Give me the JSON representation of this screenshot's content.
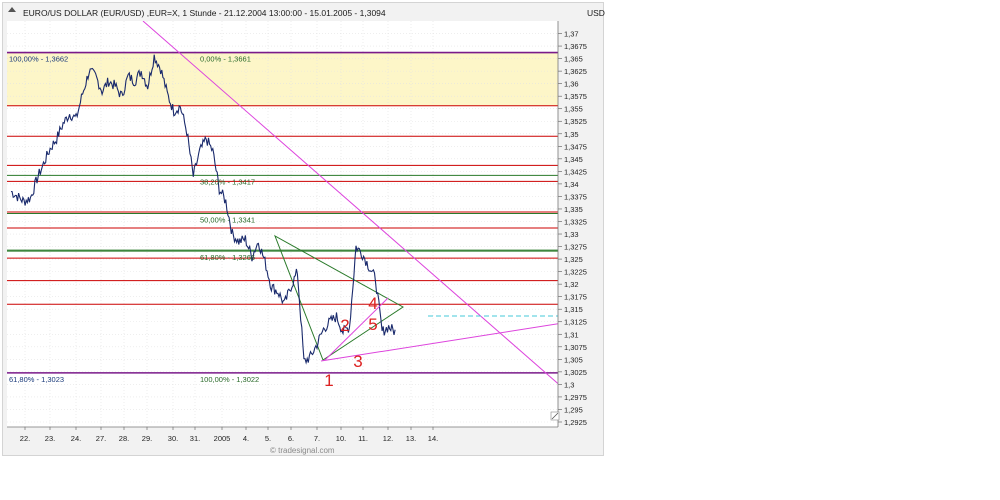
{
  "header": {
    "title": "EURO/US DOLLAR (EUR/USD) ,EUR=X, 1 Stunde - 21.12.2004 13:00:00 - 15.01.2005 - 1,3094",
    "currency": "USD",
    "watermark": "© tradesignal.com"
  },
  "colors": {
    "price": "#1a2a6c",
    "fib_red": "#cc0000",
    "fib_green": "#2a7a2a",
    "fib_purple": "#7a1a8a",
    "trend_magenta": "#dd44dd",
    "zone_yellow": "#fdf6c8",
    "wave_red": "#dd2222",
    "wave_green": "#22aa22",
    "projection_cyan": "#44c8d8"
  },
  "chart_data": {
    "type": "line",
    "title": "EURO/US DOLLAR (EUR/USD) ,EUR=X, 1 Stunde - 21.12.2004 13:00:00 - 15.01.2005 - 1,3094",
    "ylabel": "USD",
    "ylim": [
      1.2915,
      1.3725
    ],
    "y_ticks": [
      1.37,
      1.3675,
      1.365,
      1.3625,
      1.36,
      1.3575,
      1.355,
      1.3525,
      1.35,
      1.3475,
      1.345,
      1.3425,
      1.34,
      1.3375,
      1.335,
      1.3325,
      1.33,
      1.3275,
      1.325,
      1.3225,
      1.32,
      1.3175,
      1.315,
      1.3125,
      1.31,
      1.3075,
      1.305,
      1.3025,
      1.3,
      1.2975,
      1.295,
      1.2925
    ],
    "y_tick_labels": [
      "1,37",
      "1,3675",
      "1,365",
      "1,3625",
      "1,36",
      "1,3575",
      "1,355",
      "1,3525",
      "1,35",
      "1,3475",
      "1,345",
      "1,3425",
      "1,34",
      "1,3375",
      "1,335",
      "1,3325",
      "1,33",
      "1,3275",
      "1,325",
      "1,3225",
      "1,32",
      "1,3175",
      "1,315",
      "1,3125",
      "1,31",
      "1,3075",
      "1,305",
      "1,3025",
      "1,3",
      "1,2975",
      "1,295",
      "1,2925"
    ],
    "x_labels": [
      "22.",
      "23.",
      "24.",
      "27.",
      "28.",
      "29.",
      "30.",
      "31.",
      "2005",
      "4.",
      "5.",
      "6.",
      "7.",
      "10.",
      "11.",
      "12.",
      "13.",
      "14."
    ],
    "series": [
      {
        "x": [
          0,
          0.3,
          0.6,
          0.9,
          1.2,
          1.5,
          1.8,
          2.1,
          2.4,
          2.7,
          3.0,
          3.3,
          3.6,
          3.9,
          4.2,
          4.5,
          4.8,
          5.1,
          5.4,
          5.7,
          6.0,
          6.3,
          6.6,
          6.9,
          7.2,
          7.5,
          7.8,
          8.1,
          8.4,
          8.7,
          9.0,
          9.3,
          9.6,
          9.9,
          10.2,
          10.5,
          10.8,
          11.1,
          11.4,
          11.7,
          12.0,
          12.3,
          12.6,
          12.9,
          13.2,
          13.5,
          13.8,
          14.1,
          14.4,
          14.7,
          15.0,
          15.3,
          15.6,
          15.9,
          16.2,
          16.5,
          16.8,
          17.1,
          17.4,
          17.7
        ],
        "values": [
          1.3385,
          1.3375,
          1.3365,
          1.3372,
          1.341,
          1.344,
          1.347,
          1.349,
          1.352,
          1.354,
          1.353,
          1.358,
          1.3625,
          1.3615,
          1.3585,
          1.3605,
          1.3595,
          1.3575,
          1.3615,
          1.3605,
          1.3625,
          1.3595,
          1.3655,
          1.363,
          1.358,
          1.3545,
          1.3555,
          1.3505,
          1.3415,
          1.3465,
          1.349,
          1.3465,
          1.339,
          1.3365,
          1.33,
          1.3285,
          1.329,
          1.3255,
          1.3285,
          1.3245,
          1.3195,
          1.3185,
          1.316,
          1.3195,
          1.3225,
          1.3045,
          1.3055,
          1.308,
          1.311,
          1.3125,
          1.3135,
          1.3105,
          1.3115,
          1.3275,
          1.326,
          1.3235,
          1.321,
          1.3105,
          1.3115,
          1.3105
        ]
      }
    ],
    "fib_levels": [
      {
        "value": 1.3662,
        "color": "purple",
        "label_left": "100,00% - 1,3662",
        "label_mid": "0,00% - 1,3661"
      },
      {
        "value": 1.3556,
        "color": "red"
      },
      {
        "value": 1.3495,
        "color": "red"
      },
      {
        "value": 1.3437,
        "color": "red"
      },
      {
        "value": 1.3417,
        "color": "green",
        "label_mid": "38,20% - 1,3417"
      },
      {
        "value": 1.3405,
        "color": "red"
      },
      {
        "value": 1.3344,
        "color": "red"
      },
      {
        "value": 1.3341,
        "color": "green",
        "label_mid": "50,00% - 1,3341"
      },
      {
        "value": 1.3312,
        "color": "red"
      },
      {
        "value": 1.3268,
        "color": "green"
      },
      {
        "value": 1.3252,
        "color": "red"
      },
      {
        "value": 1.3266,
        "color": "green",
        "label_mid": "61,80% - 1,3266"
      },
      {
        "value": 1.3207,
        "color": "red"
      },
      {
        "value": 1.316,
        "color": "red"
      },
      {
        "value": 1.3023,
        "color": "purple",
        "label_left": "61,80% - 1,3023",
        "label_mid": "100,00% - 1,3022"
      }
    ],
    "wave_labels": [
      "1",
      "2",
      "3",
      "4",
      "5"
    ],
    "grid": true,
    "legend": "none"
  }
}
